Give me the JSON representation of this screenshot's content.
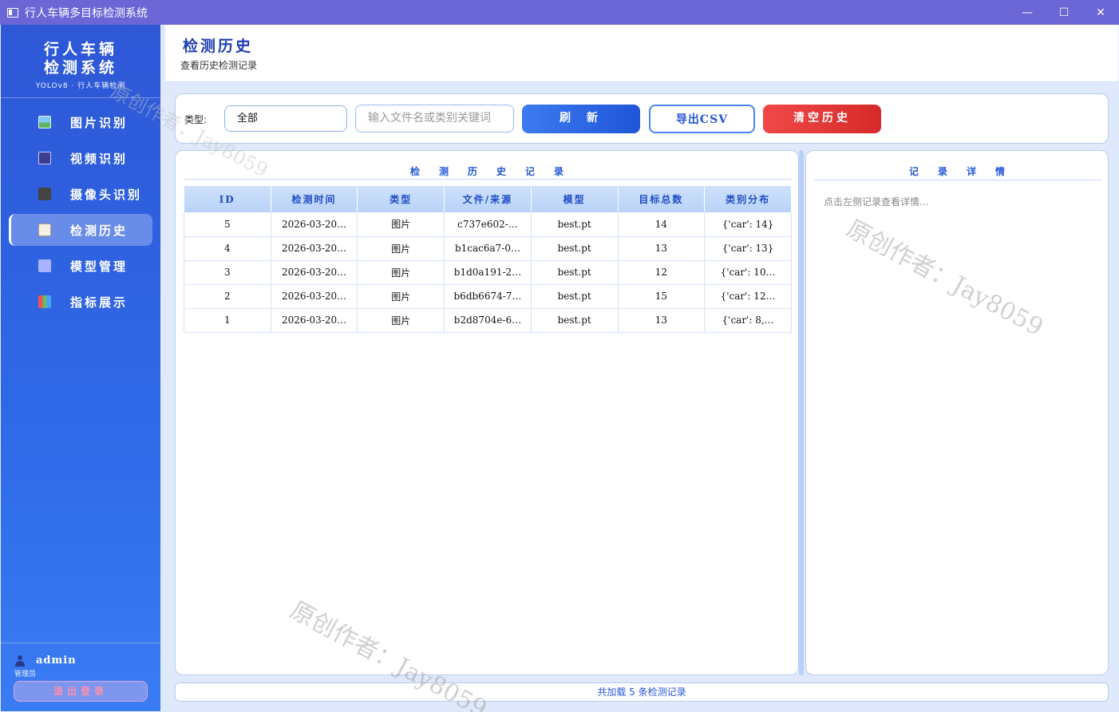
{
  "window": {
    "title": "行人车辆多目标检测系统",
    "controls": {
      "minimize": "—",
      "maximize": "☐",
      "close": "✕"
    }
  },
  "sidebar": {
    "title_line1": "行人车辆",
    "title_line2": "检测系统",
    "subtitle": "YOLOv8 · 行人车辆检测",
    "items": [
      {
        "label": "图片识别",
        "icon": "image-icon"
      },
      {
        "label": "视频识别",
        "icon": "video-icon"
      },
      {
        "label": "摄像头识别",
        "icon": "camera-icon"
      },
      {
        "label": "检测历史",
        "icon": "history-icon",
        "active": true
      },
      {
        "label": "模型管理",
        "icon": "gear-icon"
      },
      {
        "label": "指标展示",
        "icon": "chart-icon"
      }
    ],
    "user": {
      "name": "admin",
      "role": "管理员"
    },
    "logout_label": "退出登录"
  },
  "header": {
    "title": "检测历史",
    "subtitle": "查看历史检测记录"
  },
  "toolbar": {
    "type_label": "类型:",
    "type_value": "全部",
    "search_placeholder": "输入文件名或类别关键词",
    "refresh_label": "刷新",
    "export_label": "导出CSV",
    "clear_label": "清空历史"
  },
  "history_panel": {
    "title": "检测历史记录",
    "columns": [
      "ID",
      "检测时间",
      "类型",
      "文件/来源",
      "模型",
      "目标总数",
      "类别分布"
    ],
    "rows": [
      [
        "5",
        "2026-03-20…",
        "图片",
        "c737e602-…",
        "best.pt",
        "14",
        "{'car': 14}"
      ],
      [
        "4",
        "2026-03-20…",
        "图片",
        "b1cac6a7-0…",
        "best.pt",
        "13",
        "{'car': 13}"
      ],
      [
        "3",
        "2026-03-20…",
        "图片",
        "b1d0a191-2…",
        "best.pt",
        "12",
        "{'car': 10…"
      ],
      [
        "2",
        "2026-03-20…",
        "图片",
        "b6db6674-7…",
        "best.pt",
        "15",
        "{'car': 12…"
      ],
      [
        "1",
        "2026-03-20…",
        "图片",
        "b2d8704e-6…",
        "best.pt",
        "13",
        "{'car': 8,…"
      ]
    ]
  },
  "detail_panel": {
    "title": "记录详情",
    "placeholder": "点击左侧记录查看详情…"
  },
  "status": "共加载 5 条检测记录",
  "watermarks": {
    "main": "原创作者：Jay8059",
    "small": "原创作者：Jay8059"
  },
  "colors": {
    "titlebar": "#6b66d6",
    "sidebar": "#2f6ae8",
    "accent": "#2456d6",
    "danger": "#e03535"
  }
}
